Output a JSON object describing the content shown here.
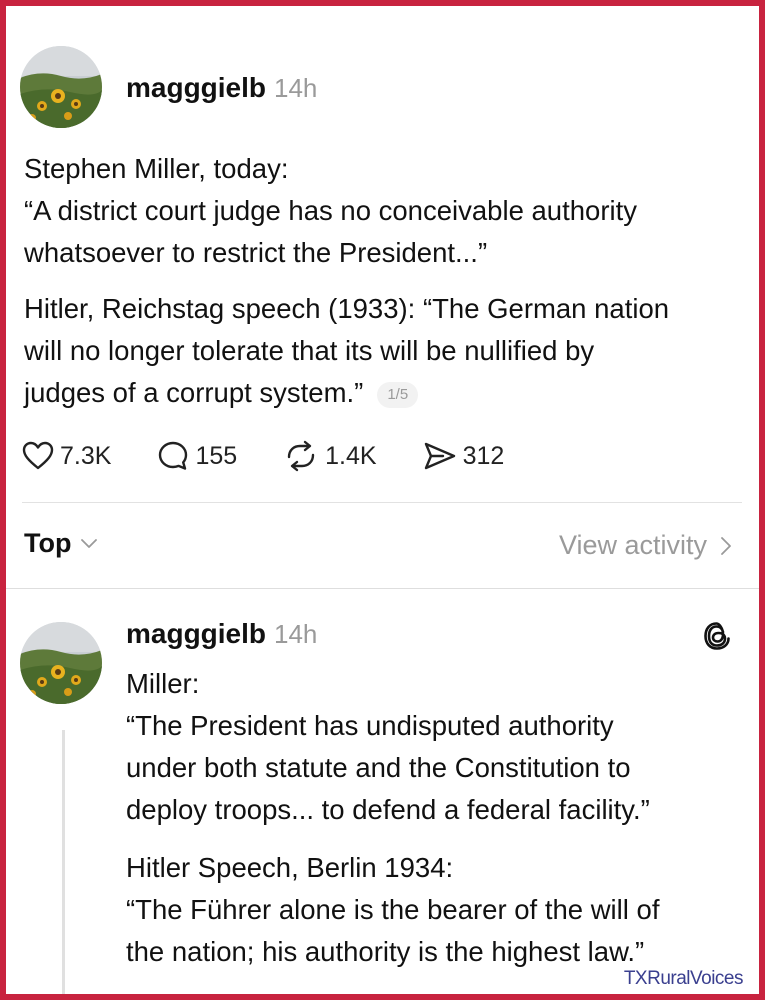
{
  "post1": {
    "username": "magggielb",
    "time": "14h",
    "lines": [
      "Stephen Miller, today:",
      "“A district court judge has no conceivable authority",
      "whatsoever to restrict the President...”"
    ],
    "lines2": [
      "Hitler, Reichstag speech (1933): “The German nation",
      "will no longer tolerate that its will be nullified by",
      "judges of a corrupt system.”"
    ],
    "counter": "1/5",
    "likes": "7.3K",
    "comments": "155",
    "reposts": "1.4K",
    "shares": "312"
  },
  "sort": {
    "label": "Top",
    "view_activity": "View activity"
  },
  "post2": {
    "username": "magggielb",
    "time": "14h",
    "lines": [
      "Miller:",
      "“The President has undisputed authority",
      "under both statute and the Constitution to",
      "deploy troops... to defend a federal facility.”"
    ],
    "lines2": [
      "Hitler Speech, Berlin 1934:",
      "“The Führer alone is the bearer of the will of",
      "the nation; his authority is the highest law.”"
    ]
  },
  "watermark": "TXRuralVoices",
  "colors": {
    "frame": "#c8233f",
    "muted": "#9a9a9a",
    "watermark": "#3a3f8f"
  },
  "icons": [
    "heart-icon",
    "comment-icon",
    "repost-icon",
    "share-icon",
    "chevron-down-icon",
    "chevron-right-icon",
    "threads-logo-icon"
  ]
}
